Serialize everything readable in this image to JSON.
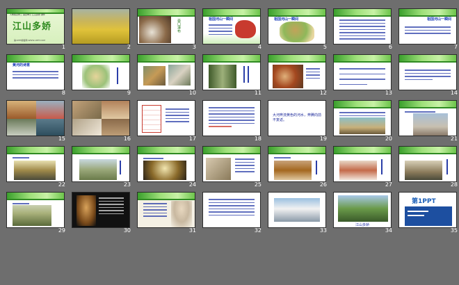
{
  "title_slide": {
    "header_text": "人教版必修二 第四单元 江山多娇 课件",
    "title": "江山多娇",
    "footer": "第1PPT模板网-WWW.1PPT.COM"
  },
  "slide_3_caption": "壶口瀑布",
  "slide_4_title": "祖国河山一瞬间",
  "slide_5_title": "祖国河山一瞬间",
  "slide_7_title": "祖国河山一瞬间",
  "slide_8_title": "黄河的诗意",
  "slide_19_text": "大河奔流黄色的河水，奔腾向前不复返。",
  "slide_33_caption": "",
  "slide_34_caption": "江山多娇",
  "slide_35_brand": "第1PPT",
  "slides": [
    {
      "n": "1"
    },
    {
      "n": "2"
    },
    {
      "n": "3"
    },
    {
      "n": "4"
    },
    {
      "n": "5"
    },
    {
      "n": "6"
    },
    {
      "n": "7"
    },
    {
      "n": "8"
    },
    {
      "n": "9"
    },
    {
      "n": "10"
    },
    {
      "n": "11"
    },
    {
      "n": "12"
    },
    {
      "n": "13"
    },
    {
      "n": "14"
    },
    {
      "n": "15"
    },
    {
      "n": "16"
    },
    {
      "n": "17"
    },
    {
      "n": "18"
    },
    {
      "n": "19"
    },
    {
      "n": "20"
    },
    {
      "n": "21"
    },
    {
      "n": "22"
    },
    {
      "n": "23"
    },
    {
      "n": "24"
    },
    {
      "n": "25"
    },
    {
      "n": "26"
    },
    {
      "n": "27"
    },
    {
      "n": "28"
    },
    {
      "n": "29"
    },
    {
      "n": "30"
    },
    {
      "n": "31"
    },
    {
      "n": "32"
    },
    {
      "n": "33"
    },
    {
      "n": "34"
    },
    {
      "n": "35"
    }
  ]
}
